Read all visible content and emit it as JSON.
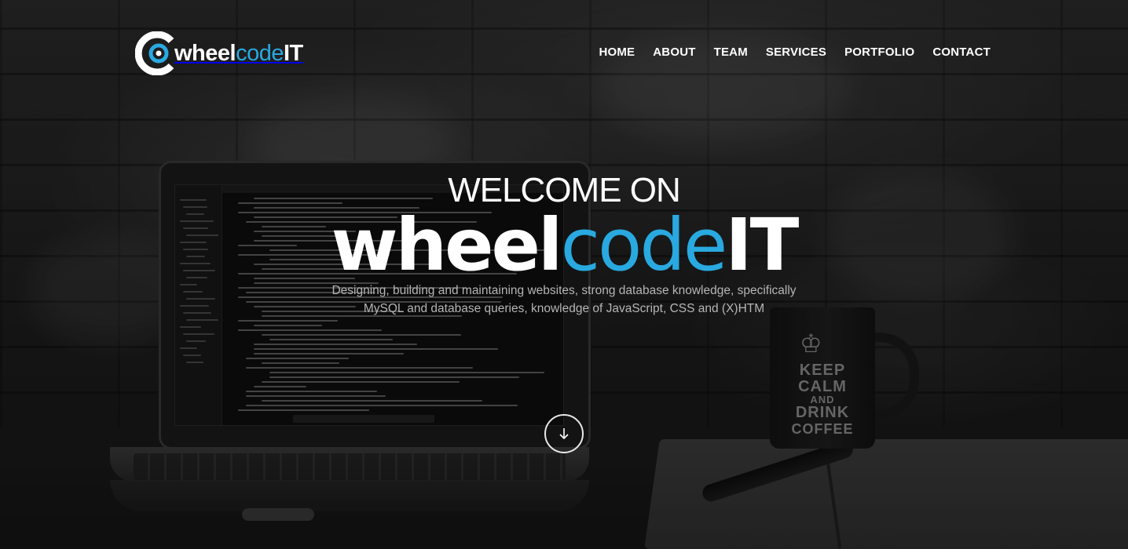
{
  "logo": {
    "part1": "wheel",
    "part2": "code",
    "part3": "IT",
    "icon": "wheel-logo-icon"
  },
  "nav": [
    {
      "label": "HOME"
    },
    {
      "label": "ABOUT"
    },
    {
      "label": "TEAM"
    },
    {
      "label": "SERVICES"
    },
    {
      "label": "PORTFOLIO"
    },
    {
      "label": "CONTACT"
    }
  ],
  "hero": {
    "welcome": "WELCOME ON",
    "brand_part1": "wheel",
    "brand_part2": "code",
    "brand_part3": "IT",
    "tagline": "Designing, building and maintaining websites, strong database knowledge, specifically MySQL and database queries, knowledge of JavaScript, CSS and (X)HTM",
    "scroll_icon": "arrow-down-icon"
  },
  "background": {
    "mug_line1": "KEEP",
    "mug_line2": "CALM",
    "mug_line3": "AND",
    "mug_line4": "DRINK",
    "mug_line5": "COFFEE"
  },
  "colors": {
    "accent": "#29a9e0",
    "text": "#ffffff",
    "tagline": "#b5b5b5"
  }
}
